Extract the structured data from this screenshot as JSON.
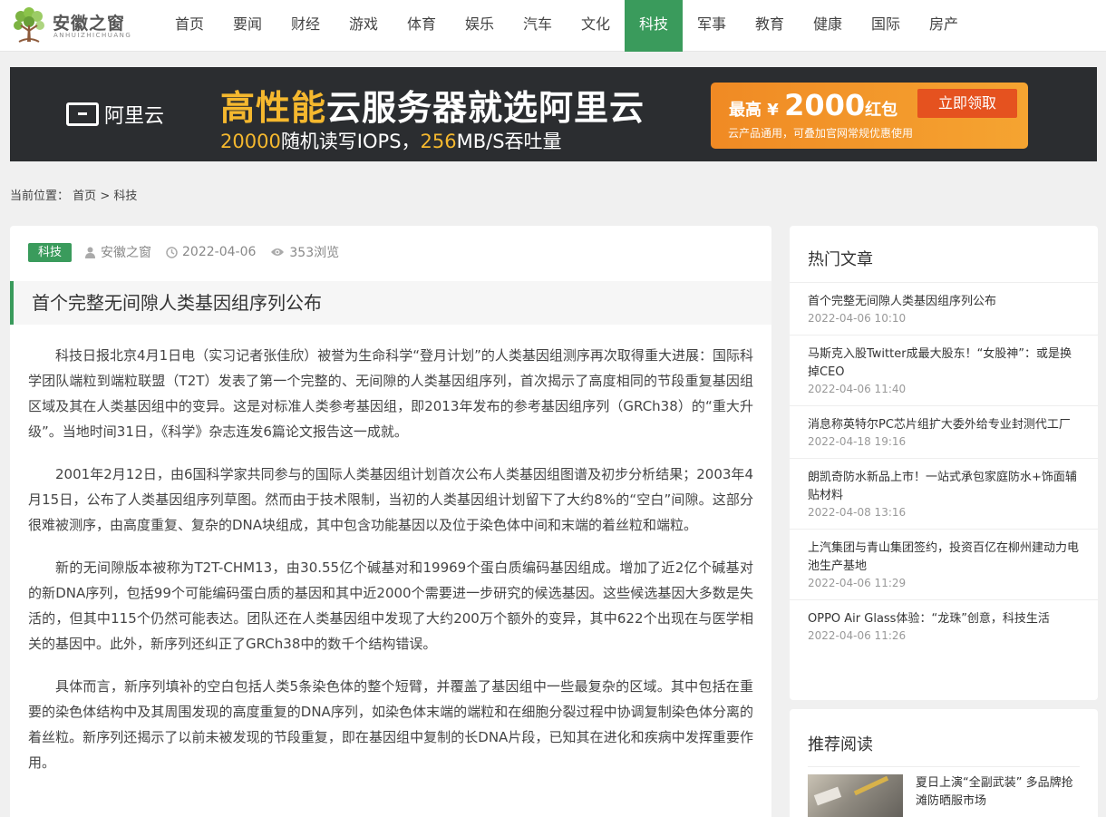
{
  "site": {
    "logo_title": "安徽之窗",
    "logo_sub": "ANHUIZHICHUANG"
  },
  "nav": {
    "items": [
      "首页",
      "要闻",
      "财经",
      "游戏",
      "体育",
      "娱乐",
      "汽车",
      "文化",
      "科技",
      "军事",
      "教育",
      "健康",
      "国际",
      "房产"
    ],
    "active": "科技"
  },
  "banner": {
    "brand": "阿里云",
    "headline_highlight": "高性能",
    "headline_rest": "云服务器就选阿里云",
    "sub_num1": "20000",
    "sub_text1": "随机读写IOPS，",
    "sub_num2": "256",
    "sub_text2": "MB/S吞吐量",
    "coupon_prefix": "最高 ¥ ",
    "coupon_amount": "2000",
    "coupon_suffix": "红包",
    "coupon_note": "云产品通用，可叠加官网常规优惠使用",
    "coupon_button": "立即领取"
  },
  "breadcrumb": {
    "label": "当前位置：",
    "home": "首页",
    "sep": ">",
    "current": "科技"
  },
  "article": {
    "category": "科技",
    "author": "安徽之窗",
    "date": "2022-04-06",
    "views": "353浏览",
    "title": "首个完整无间隙人类基因组序列公布",
    "paragraphs": [
      "科技日报北京4月1日电（实习记者张佳欣）被誉为生命科学“登月计划”的人类基因组测序再次取得重大进展：国际科学团队端粒到端粒联盟（T2T）发表了第一个完整的、无间隙的人类基因组序列，首次揭示了高度相同的节段重复基因组区域及其在人类基因组中的变异。这是对标准人类参考基因组，即2013年发布的参考基因组序列（GRCh38）的“重大升级”。当地时间31日，《科学》杂志连发6篇论文报告这一成就。",
      "2001年2月12日，由6国科学家共同参与的国际人类基因组计划首次公布人类基因组图谱及初步分析结果；2003年4月15日，公布了人类基因组序列草图。然而由于技术限制，当初的人类基因组计划留下了大约8%的“空白”间隙。这部分很难被测序，由高度重复、复杂的DNA块组成，其中包含功能基因以及位于染色体中间和末端的着丝粒和端粒。",
      "新的无间隙版本被称为T2T-CHM13，由30.55亿个碱基对和19969个蛋白质编码基因组成。增加了近2亿个碱基对的新DNA序列，包括99个可能编码蛋白质的基因和其中近2000个需要进一步研究的候选基因。这些候选基因大多数是失活的，但其中115个仍然可能表达。团队还在人类基因组中发现了大约200万个额外的变异，其中622个出现在与医学相关的基因中。此外，新序列还纠正了GRCh38中的数千个结构错误。",
      "具体而言，新序列填补的空白包括人类5条染色体的整个短臂，并覆盖了基因组中一些最复杂的区域。其中包括在重要的染色体结构中及其周围发现的高度重复的DNA序列，如染色体末端的端粒和在细胞分裂过程中协调复制染色体分离的着丝粒。新序列还揭示了以前未被发现的节段重复，即在基因组中复制的长DNA片段，已知其在进化和疾病中发挥重要作用。"
    ]
  },
  "sidebar": {
    "hot_title": "热门文章",
    "hot_items": [
      {
        "title": "首个完整无间隙人类基因组序列公布",
        "date": "2022-04-06 10:10"
      },
      {
        "title": "马斯克入股Twitter成最大股东！“女股神”：或是换掉CEO",
        "date": "2022-04-06 11:40"
      },
      {
        "title": "消息称英特尔PC芯片组扩大委外给专业封测代工厂",
        "date": "2022-04-18 19:16"
      },
      {
        "title": "朗凯奇防水新品上市！一站式承包家庭防水+饰面辅贴材料",
        "date": "2022-04-08 13:16"
      },
      {
        "title": "上汽集团与青山集团签约，投资百亿在柳州建动力电池生产基地",
        "date": "2022-04-06 11:29"
      },
      {
        "title": "OPPO Air Glass体验：“龙珠”创意，科技生活",
        "date": "2022-04-06 11:26"
      }
    ],
    "rec_title": "推荐阅读",
    "rec_items": [
      {
        "title": "夏日上演“全副武装” 多品牌抢滩防晒服市场"
      }
    ]
  }
}
